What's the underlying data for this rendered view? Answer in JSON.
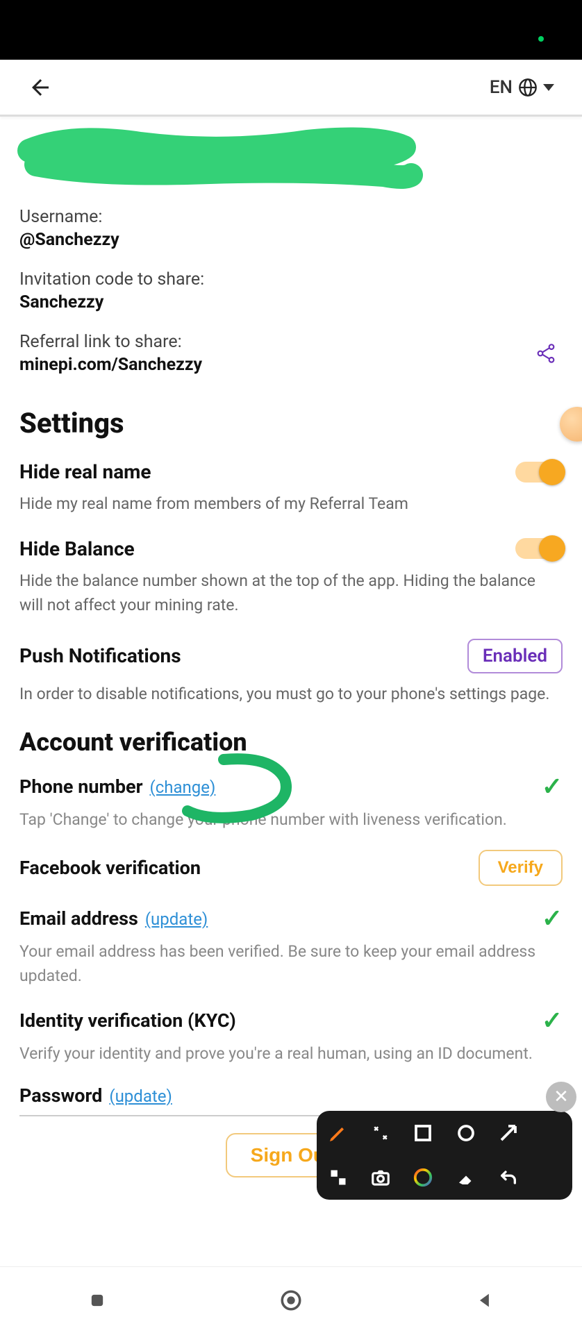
{
  "header": {
    "language": "EN"
  },
  "profile": {
    "username_label": "Username:",
    "username_value": "@Sanchezzy",
    "invite_label": "Invitation code to share:",
    "invite_value": "Sanchezzy",
    "referral_label": "Referral link to share:",
    "referral_value": "minepi.com/Sanchezzy"
  },
  "settings": {
    "title": "Settings",
    "hide_name": {
      "title": "Hide real name",
      "desc": "Hide my real name from members of my Referral Team"
    },
    "hide_balance": {
      "title": "Hide Balance",
      "desc": "Hide the balance number shown at the top of the app. Hiding the balance will not affect your mining rate."
    },
    "push": {
      "title": "Push Notifications",
      "badge": "Enabled",
      "desc": "In order to disable notifications, you must go to your phone's settings page."
    }
  },
  "verification": {
    "title": "Account verification",
    "phone": {
      "title": "Phone number",
      "link": "(change)",
      "desc": "Tap 'Change' to change your phone number with liveness verification."
    },
    "facebook": {
      "title": "Facebook verification",
      "button": "Verify"
    },
    "email": {
      "title": "Email address",
      "link": "(update)",
      "desc": "Your email address has been verified. Be sure to keep your email address updated."
    },
    "kyc": {
      "title": "Identity verification (KYC)",
      "desc": "Verify your identity and prove you're a real human, using an ID document."
    },
    "password": {
      "title": "Password",
      "link": "(update)"
    }
  },
  "signout": "Sign Out"
}
